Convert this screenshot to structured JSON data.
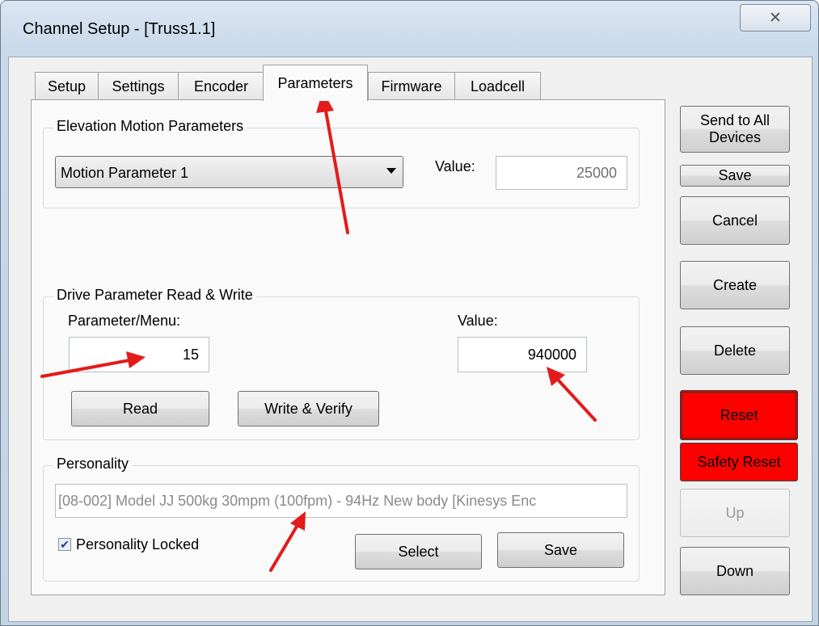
{
  "window": {
    "title": "Channel Setup - [Truss1.1]",
    "close_glyph": "✕"
  },
  "tabs": [
    {
      "label": "Setup"
    },
    {
      "label": "Settings"
    },
    {
      "label": "Encoder"
    },
    {
      "label": "Parameters"
    },
    {
      "label": "Firmware"
    },
    {
      "label": "Loadcell"
    }
  ],
  "active_tab": "Parameters",
  "elevation": {
    "group_label": "Elevation Motion Parameters",
    "selected": "Motion Parameter 1",
    "value_label": "Value:",
    "value": "25000"
  },
  "drive": {
    "group_label": "Drive Parameter Read & Write",
    "param_label": "Parameter/Menu:",
    "param_value": "15",
    "value_label": "Value:",
    "value": "940000",
    "read_label": "Read",
    "write_label": "Write & Verify"
  },
  "personality": {
    "group_label": "Personality",
    "text": "[08-002] Model JJ 500kg 30mpm (100fpm) - 94Hz New body [Kinesys Enc",
    "locked_label": "Personality Locked",
    "locked": true,
    "check_glyph": "✔",
    "select_label": "Select",
    "save_label": "Save"
  },
  "side_buttons": {
    "send_all": "Send to All Devices",
    "save": "Save",
    "cancel": "Cancel",
    "create": "Create",
    "delete": "Delete",
    "reset": "Reset",
    "safety_reset": "Safety Reset",
    "up": "Up",
    "down": "Down"
  },
  "colors": {
    "reset_red": "#ff0000",
    "annotation_red": "#e31b1b"
  }
}
